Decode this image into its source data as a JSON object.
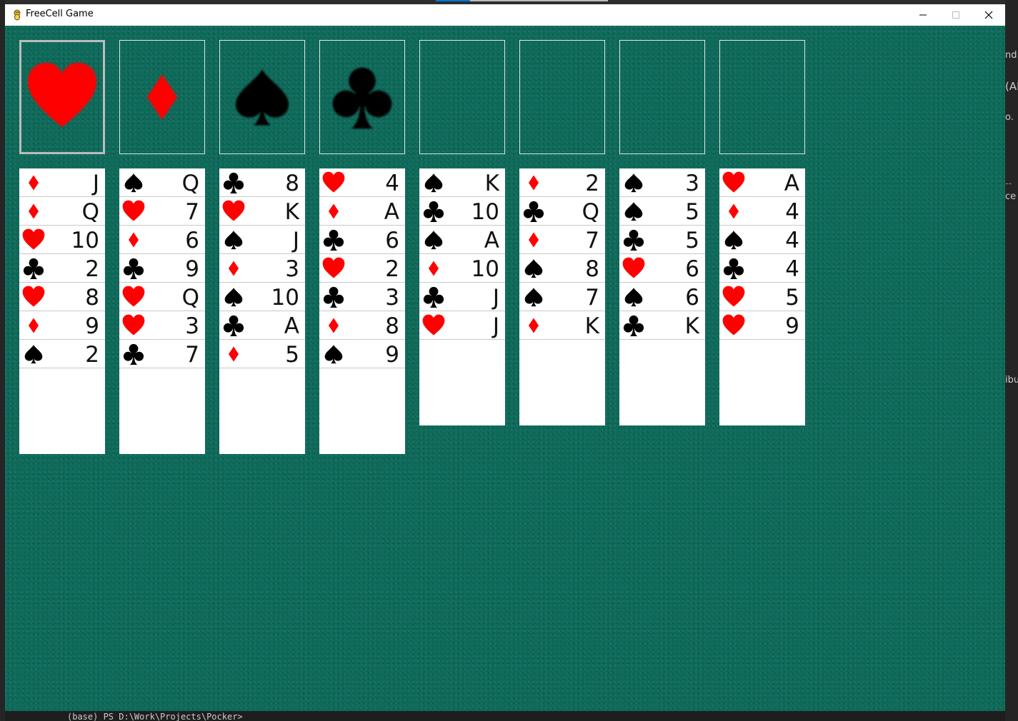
{
  "window": {
    "title": "FreeCell Game",
    "minimize_symbol": "—",
    "maximize_symbol": "☐",
    "close_symbol": "✕"
  },
  "colors": {
    "felt": "#0c6a5a",
    "red_suit": "#ff0000",
    "black_suit": "#000000",
    "card_face": "#ffffff"
  },
  "background": {
    "terminal_prompt": "(base) PS D:\\Work\\Projects\\Pocker> ",
    "right_fragments": [
      "nd",
      "(AM",
      "o.",
      "--",
      "ce",
      "ibu"
    ]
  },
  "top_slots": [
    {
      "name": "slot-1",
      "suit": "hearts",
      "selected": true
    },
    {
      "name": "slot-2",
      "suit": "diamonds",
      "selected": false
    },
    {
      "name": "slot-3",
      "suit": "spades",
      "selected": false
    },
    {
      "name": "slot-4",
      "suit": "clubs",
      "selected": false
    },
    {
      "name": "slot-5",
      "suit": "",
      "selected": false
    },
    {
      "name": "slot-6",
      "suit": "",
      "selected": false
    },
    {
      "name": "slot-7",
      "suit": "",
      "selected": false
    },
    {
      "name": "slot-8",
      "suit": "",
      "selected": false
    }
  ],
  "columns": [
    {
      "cards": [
        {
          "suit": "diamonds",
          "rank": "J"
        },
        {
          "suit": "diamonds",
          "rank": "Q"
        },
        {
          "suit": "hearts",
          "rank": "10"
        },
        {
          "suit": "clubs",
          "rank": "2"
        },
        {
          "suit": "hearts",
          "rank": "8"
        },
        {
          "suit": "diamonds",
          "rank": "9"
        },
        {
          "suit": "spades",
          "rank": "2"
        }
      ]
    },
    {
      "cards": [
        {
          "suit": "spades",
          "rank": "Q"
        },
        {
          "suit": "hearts",
          "rank": "7"
        },
        {
          "suit": "diamonds",
          "rank": "6"
        },
        {
          "suit": "clubs",
          "rank": "9"
        },
        {
          "suit": "hearts",
          "rank": "Q"
        },
        {
          "suit": "hearts",
          "rank": "3"
        },
        {
          "suit": "clubs",
          "rank": "7"
        }
      ]
    },
    {
      "cards": [
        {
          "suit": "clubs",
          "rank": "8"
        },
        {
          "suit": "hearts",
          "rank": "K"
        },
        {
          "suit": "spades",
          "rank": "J"
        },
        {
          "suit": "diamonds",
          "rank": "3"
        },
        {
          "suit": "spades",
          "rank": "10"
        },
        {
          "suit": "clubs",
          "rank": "A"
        },
        {
          "suit": "diamonds",
          "rank": "5"
        }
      ]
    },
    {
      "cards": [
        {
          "suit": "hearts",
          "rank": "4"
        },
        {
          "suit": "diamonds",
          "rank": "A"
        },
        {
          "suit": "clubs",
          "rank": "6"
        },
        {
          "suit": "hearts",
          "rank": "2"
        },
        {
          "suit": "clubs",
          "rank": "3"
        },
        {
          "suit": "diamonds",
          "rank": "8"
        },
        {
          "suit": "spades",
          "rank": "9"
        }
      ]
    },
    {
      "cards": [
        {
          "suit": "spades",
          "rank": "K"
        },
        {
          "suit": "clubs",
          "rank": "10"
        },
        {
          "suit": "spades",
          "rank": "A"
        },
        {
          "suit": "diamonds",
          "rank": "10"
        },
        {
          "suit": "clubs",
          "rank": "J"
        },
        {
          "suit": "hearts",
          "rank": "J"
        }
      ]
    },
    {
      "cards": [
        {
          "suit": "diamonds",
          "rank": "2"
        },
        {
          "suit": "clubs",
          "rank": "Q"
        },
        {
          "suit": "diamonds",
          "rank": "7"
        },
        {
          "suit": "spades",
          "rank": "8"
        },
        {
          "suit": "spades",
          "rank": "7"
        },
        {
          "suit": "diamonds",
          "rank": "K"
        }
      ]
    },
    {
      "cards": [
        {
          "suit": "spades",
          "rank": "3"
        },
        {
          "suit": "spades",
          "rank": "5"
        },
        {
          "suit": "clubs",
          "rank": "5"
        },
        {
          "suit": "hearts",
          "rank": "6"
        },
        {
          "suit": "spades",
          "rank": "6"
        },
        {
          "suit": "clubs",
          "rank": "K"
        }
      ]
    },
    {
      "cards": [
        {
          "suit": "hearts",
          "rank": "A"
        },
        {
          "suit": "diamonds",
          "rank": "4"
        },
        {
          "suit": "spades",
          "rank": "4"
        },
        {
          "suit": "clubs",
          "rank": "4"
        },
        {
          "suit": "hearts",
          "rank": "5"
        },
        {
          "suit": "hearts",
          "rank": "9"
        }
      ]
    }
  ]
}
